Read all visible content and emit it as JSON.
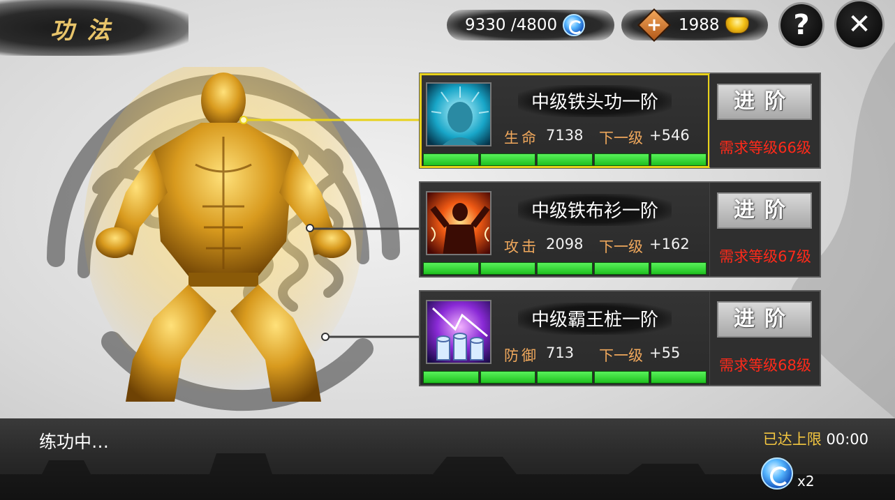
{
  "header": {
    "title": "功法",
    "energy": "9330 /4800",
    "gold": "1988",
    "plus_symbol": "+",
    "help_symbol": "?",
    "close_symbol": "✕"
  },
  "skills": [
    {
      "name": "中级铁头功一阶",
      "stat_label": "生命",
      "stat_value": "7138",
      "next_label": "下一级",
      "next_value": "+546",
      "button": "进阶",
      "requirement": "需求等级66级",
      "progress_segments_filled": 5,
      "progress_segments_total": 5,
      "selected": true,
      "icon": "iron-head-skill-icon"
    },
    {
      "name": "中级铁布衫一阶",
      "stat_label": "攻击",
      "stat_value": "2098",
      "next_label": "下一级",
      "next_value": "+162",
      "button": "进阶",
      "requirement": "需求等级67级",
      "progress_segments_filled": 5,
      "progress_segments_total": 5,
      "selected": false,
      "icon": "iron-shirt-skill-icon"
    },
    {
      "name": "中级霸王桩一阶",
      "stat_label": "防御",
      "stat_value": "713",
      "next_label": "下一级",
      "next_value": "+55",
      "button": "进阶",
      "requirement": "需求等级68级",
      "progress_segments_filled": 5,
      "progress_segments_total": 5,
      "selected": false,
      "icon": "overlord-stance-skill-icon"
    }
  ],
  "footer": {
    "status": "练功中…",
    "limit_label": "已达上限",
    "timer": "00:00",
    "multiplier": "x2"
  },
  "colors": {
    "selected_outline": "#e8d21a",
    "stat_label": "#f0a85c",
    "requirement": "#ff2a1a",
    "progress": "#2fd82f",
    "gold_text": "#f3c640"
  }
}
